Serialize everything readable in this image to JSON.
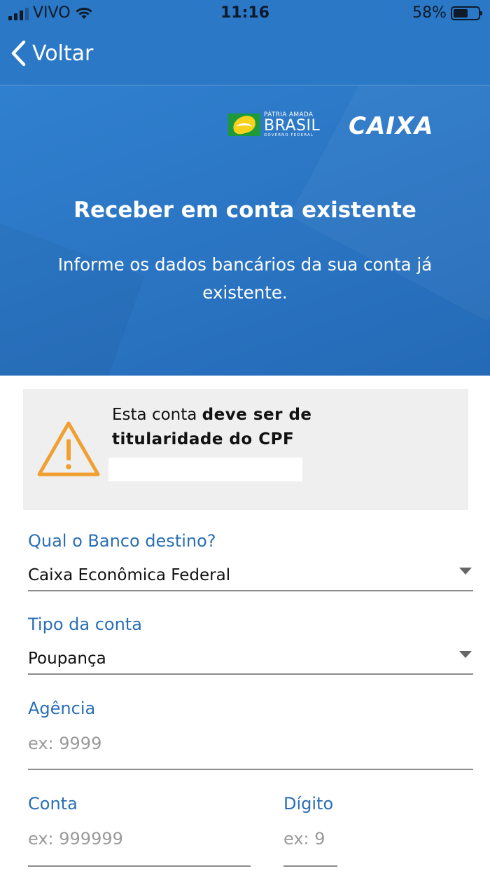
{
  "status_bar": {
    "carrier": "VIVO",
    "time": "11:16",
    "battery_percent": "58%",
    "battery_level": 0.58,
    "icons": [
      "signal-icon",
      "wifi-icon",
      "battery-icon"
    ]
  },
  "nav": {
    "back_label": "Voltar",
    "back_icon": "chevron-left-icon"
  },
  "hero": {
    "gov_logo": {
      "line1": "PÁTRIA AMADA",
      "line2": "BRASIL",
      "line3": "GOVERNO FEDERAL"
    },
    "caixa_logo": "CAIXA",
    "title": "Receber em conta existente",
    "subtitle": "Informe os dados bancários da sua conta já existente."
  },
  "warning": {
    "icon": "warning-triangle-icon",
    "text_regular": "Esta conta ",
    "text_bold": "deve ser de titularidade do CPF"
  },
  "form": {
    "bank": {
      "label": "Qual o Banco destino?",
      "value": "Caixa Econômica Federal"
    },
    "account_type": {
      "label": "Tipo da conta",
      "value": "Poupança"
    },
    "agency": {
      "label": "Agência",
      "placeholder": "ex: 9999"
    },
    "account": {
      "label": "Conta",
      "placeholder": "ex: 999999"
    },
    "digit": {
      "label": "Dígito",
      "placeholder": "ex: 9"
    }
  },
  "colors": {
    "primary_blue": "#2a78c6",
    "label_blue": "#2a6fb5",
    "warning_orange": "#f0a030",
    "warning_bg": "#f0eff0"
  }
}
